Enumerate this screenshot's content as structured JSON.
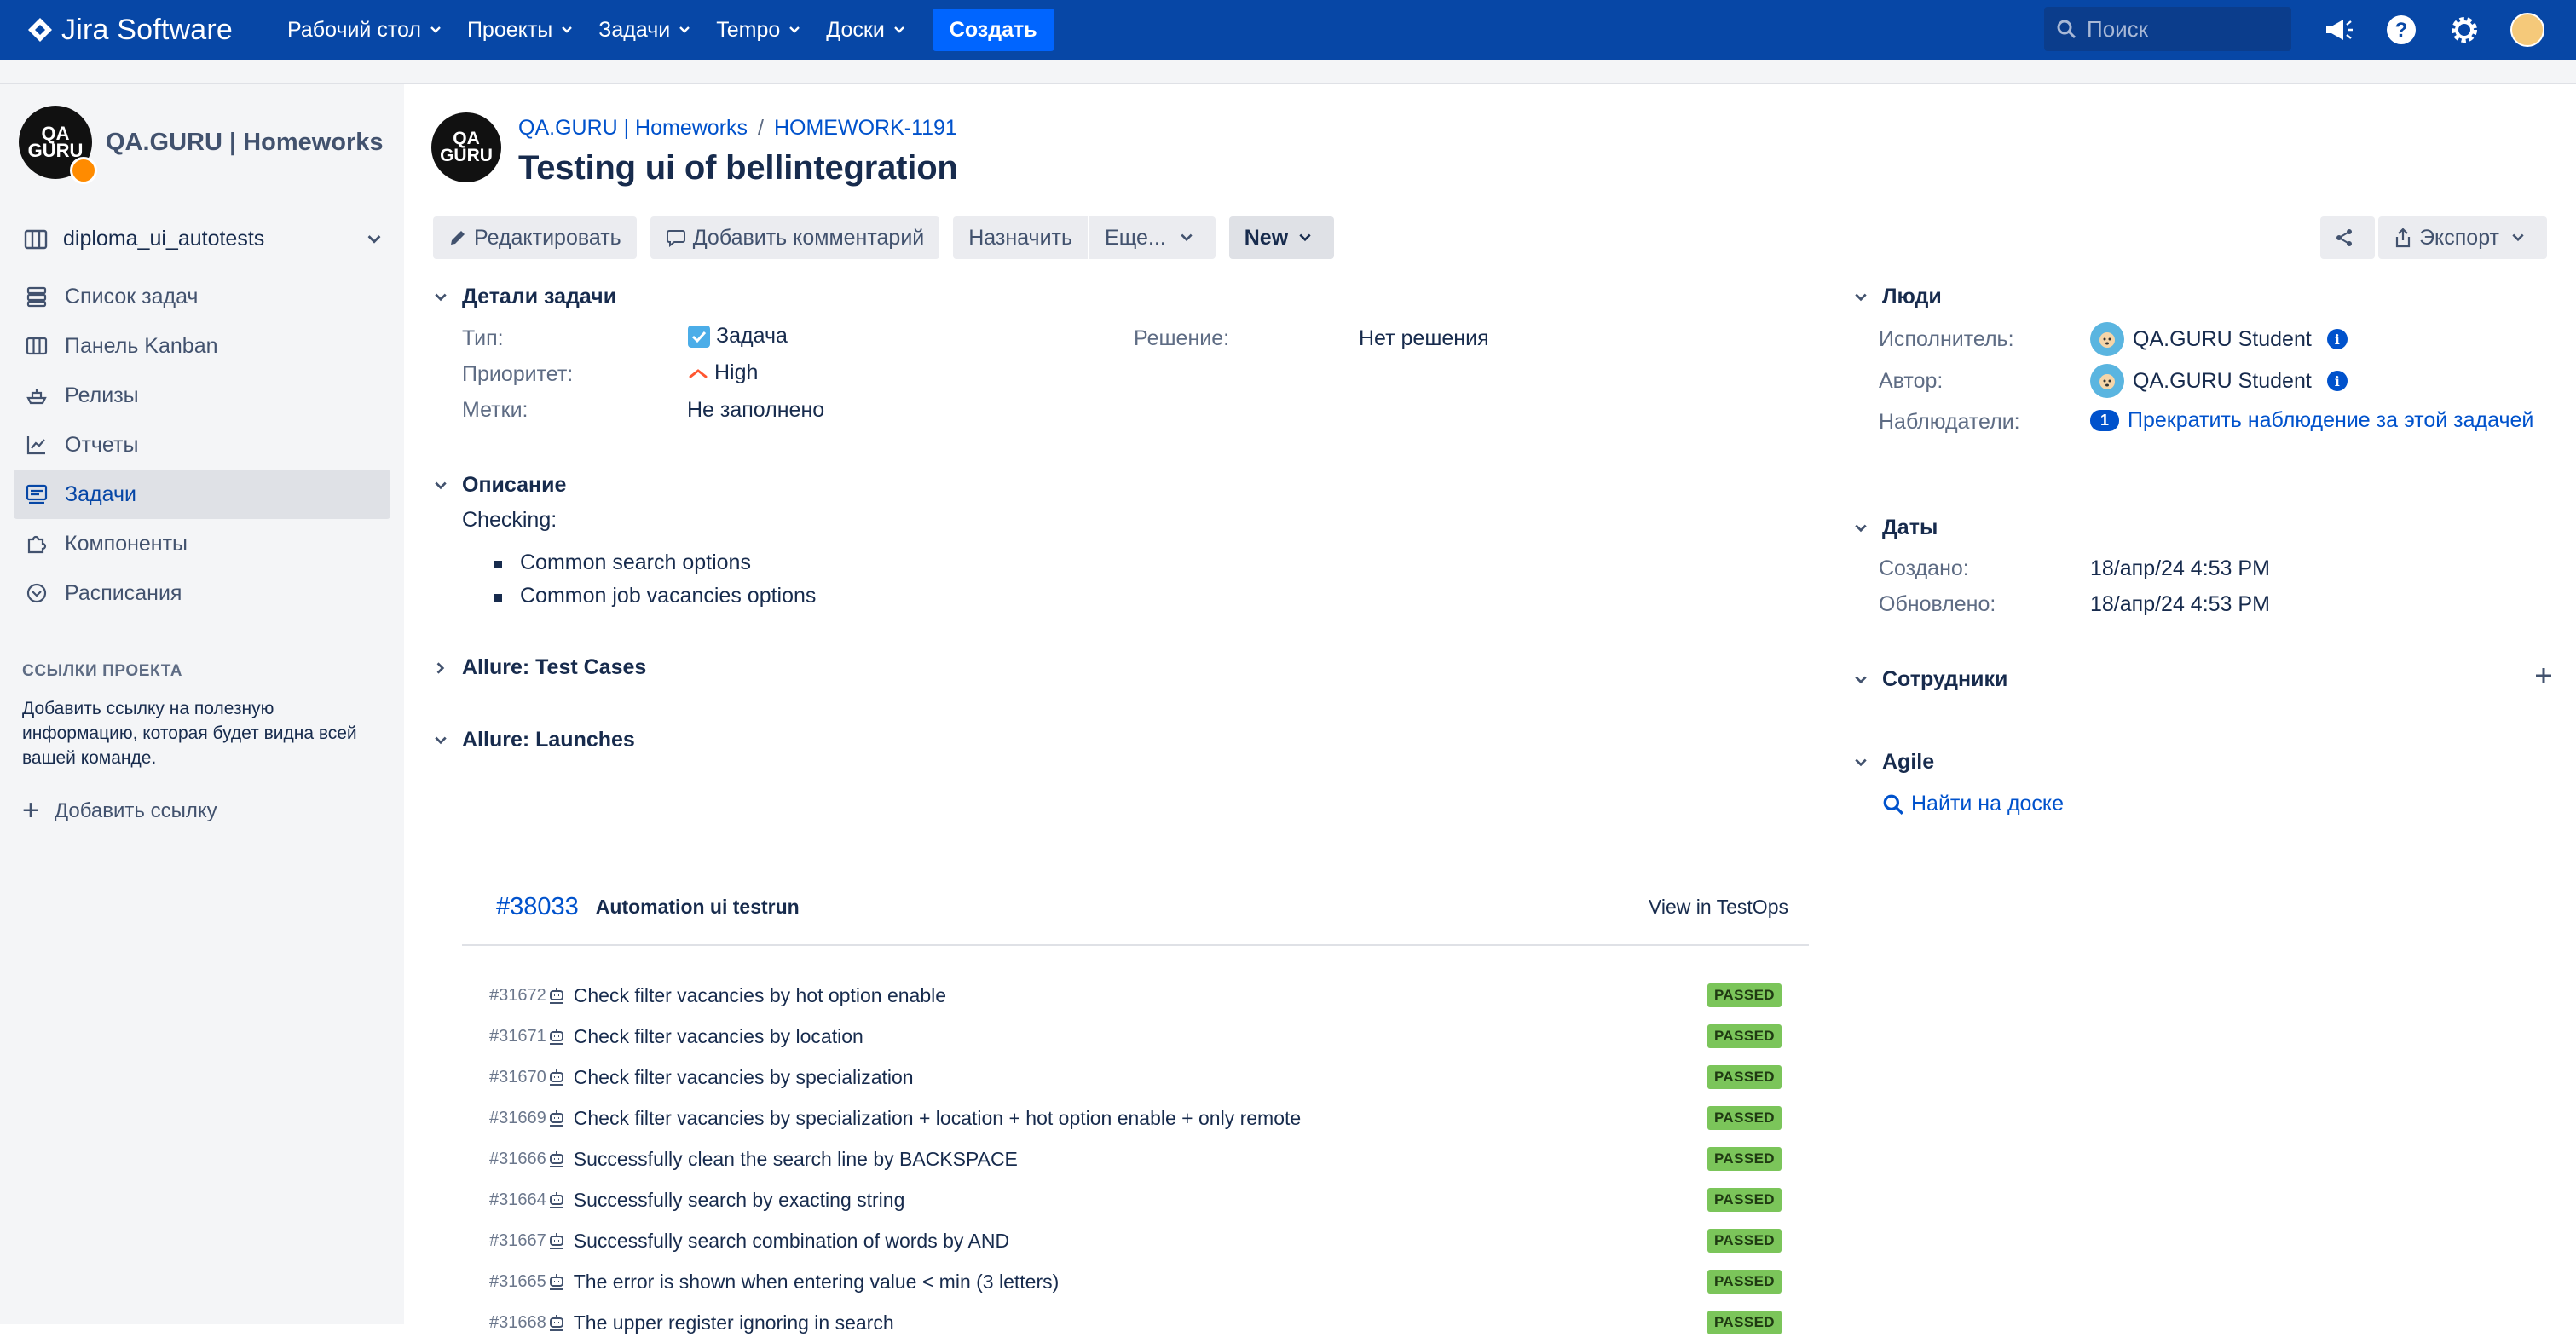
{
  "colors": {
    "topbar": "#0747a6",
    "create": "#0065ff",
    "link": "#0052cc",
    "passed": "#7bc55a"
  },
  "topbar": {
    "logo_text": "Jira Software",
    "nav": [
      "Рабочий стол",
      "Проекты",
      "Задачи",
      "Tempo",
      "Доски"
    ],
    "create_label": "Создать",
    "search_placeholder": "Поиск",
    "icons": [
      "notifications-megaphone-icon",
      "help-icon",
      "settings-gear-icon",
      "user-avatar"
    ]
  },
  "sidebar": {
    "project_avatar_text": "QA GURU",
    "project_name": "QA.GURU | Homeworks",
    "board_name": "diploma_ui_autotests",
    "items": [
      {
        "label": "Список задач",
        "icon": "backlog-icon"
      },
      {
        "label": "Панель Kanban",
        "icon": "board-icon"
      },
      {
        "label": "Релизы",
        "icon": "ship-icon"
      },
      {
        "label": "Отчеты",
        "icon": "chart-icon"
      },
      {
        "label": "Задачи",
        "icon": "issues-icon",
        "active": true
      },
      {
        "label": "Компоненты",
        "icon": "puzzle-icon"
      },
      {
        "label": "Расписания",
        "icon": "schedule-icon"
      }
    ],
    "links_heading": "ССЫЛКИ ПРОЕКТА",
    "links_text": "Добавить ссылку на полезную информацию, которая будет видна всей вашей команде.",
    "add_link": "Добавить ссылку"
  },
  "issue": {
    "avatar_text": "QA GURU",
    "breadcrumb": [
      "QA.GURU | Homeworks",
      "HOMEWORK-1191"
    ],
    "title": "Testing ui of bellintegration",
    "toolbar": {
      "edit": "Редактировать",
      "comment": "Добавить комментарий",
      "assign": "Назначить",
      "more": "Еще...",
      "status": "New",
      "export": "Экспорт"
    },
    "details": {
      "heading": "Детали задачи",
      "type_label": "Тип:",
      "type_value": "Задача",
      "priority_label": "Приоритет:",
      "priority_value": "High",
      "labels_label": "Метки:",
      "labels_value": "Не заполнено",
      "resolution_label": "Решение:",
      "resolution_value": "Нет решения"
    },
    "description": {
      "heading": "Описание",
      "intro": "Checking:",
      "items": [
        "Common search options",
        "Common job vacancies options"
      ]
    },
    "test_cases_heading": "Allure: Test Cases",
    "launches": {
      "heading": "Allure: Launches",
      "id": "#38033",
      "name": "Automation ui testrun",
      "view_link": "View in TestOps",
      "tests": [
        {
          "id": "#31672",
          "name": "Check filter vacancies by hot option enable",
          "status": "PASSED"
        },
        {
          "id": "#31671",
          "name": "Check filter vacancies by location",
          "status": "PASSED"
        },
        {
          "id": "#31670",
          "name": "Check filter vacancies by specialization",
          "status": "PASSED"
        },
        {
          "id": "#31669",
          "name": "Check filter vacancies by specialization + location + hot option enable + only remote",
          "status": "PASSED"
        },
        {
          "id": "#31666",
          "name": "Successfully clean the search line by BACKSPACE",
          "status": "PASSED"
        },
        {
          "id": "#31664",
          "name": "Successfully search by exacting string",
          "status": "PASSED"
        },
        {
          "id": "#31667",
          "name": "Successfully search combination of words by AND",
          "status": "PASSED"
        },
        {
          "id": "#31665",
          "name": "The error is shown when entering value < min (3 letters)",
          "status": "PASSED"
        },
        {
          "id": "#31668",
          "name": "The upper register ignoring in search",
          "status": "PASSED"
        }
      ]
    }
  },
  "people": {
    "heading": "Люди",
    "assignee_label": "Исполнитель:",
    "assignee": "QA.GURU Student",
    "reporter_label": "Автор:",
    "reporter": "QA.GURU Student",
    "watchers_label": "Наблюдатели:",
    "watchers_count": "1",
    "watch_action": "Прекратить наблюдение за этой задачей"
  },
  "dates": {
    "heading": "Даты",
    "created_label": "Создано:",
    "created": "18/апр/24 4:53 PM",
    "updated_label": "Обновлено:",
    "updated": "18/апр/24 4:53 PM"
  },
  "staff": {
    "heading": "Сотрудники"
  },
  "agile": {
    "heading": "Agile",
    "find_on_board": "Найти на доске"
  }
}
